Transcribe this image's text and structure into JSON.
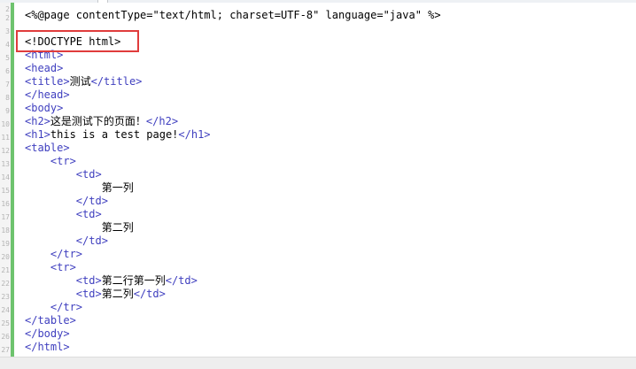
{
  "gutter": {
    "line_numbers": [
      "2",
      "2",
      "3",
      "4",
      "5",
      "6",
      "7",
      "8",
      "9",
      "10",
      "11",
      "12",
      "13",
      "14",
      "15",
      "16",
      "17",
      "18",
      "19",
      "20",
      "21",
      "22",
      "23",
      "24",
      "25",
      "26",
      "27"
    ]
  },
  "code": {
    "directive": "<%@page contentType=\"text/html; charset=UTF-8\" language=\"java\" %>",
    "doctype": "<!DOCTYPE html>",
    "lines": [
      {
        "indent": "",
        "tag_open": "<html>",
        "text": "",
        "tag_close": ""
      },
      {
        "indent": "",
        "tag_open": "<head>",
        "text": "",
        "tag_close": ""
      },
      {
        "indent": "",
        "tag_open": "<title>",
        "text": "测试",
        "tag_close": "</title>"
      },
      {
        "indent": "",
        "tag_open": "</head>",
        "text": "",
        "tag_close": ""
      },
      {
        "indent": "",
        "tag_open": "<body>",
        "text": "",
        "tag_close": ""
      },
      {
        "indent": "",
        "tag_open": "<h2>",
        "text": "这是测试下的页面！",
        "tag_close": "</h2>"
      },
      {
        "indent": "",
        "tag_open": "<h1>",
        "text": "this is a test page!",
        "tag_close": "</h1>"
      },
      {
        "indent": "",
        "tag_open": "<table>",
        "text": "",
        "tag_close": ""
      },
      {
        "indent": "    ",
        "tag_open": "<tr>",
        "text": "",
        "tag_close": ""
      },
      {
        "indent": "        ",
        "tag_open": "<td>",
        "text": "",
        "tag_close": ""
      },
      {
        "indent": "            ",
        "tag_open": "",
        "text": "第一列",
        "tag_close": ""
      },
      {
        "indent": "        ",
        "tag_open": "</td>",
        "text": "",
        "tag_close": ""
      },
      {
        "indent": "        ",
        "tag_open": "<td>",
        "text": "",
        "tag_close": ""
      },
      {
        "indent": "            ",
        "tag_open": "",
        "text": "第二列",
        "tag_close": ""
      },
      {
        "indent": "        ",
        "tag_open": "</td>",
        "text": "",
        "tag_close": ""
      },
      {
        "indent": "    ",
        "tag_open": "</tr>",
        "text": "",
        "tag_close": ""
      },
      {
        "indent": "    ",
        "tag_open": "<tr>",
        "text": "",
        "tag_close": ""
      },
      {
        "indent": "        ",
        "tag_open": "<td>",
        "text": "第二行第一列",
        "tag_close": "</td>"
      },
      {
        "indent": "        ",
        "tag_open": "<td>",
        "text": "第二列",
        "tag_close": "</td>"
      },
      {
        "indent": "    ",
        "tag_open": "</tr>",
        "text": "",
        "tag_close": ""
      },
      {
        "indent": "",
        "tag_open": "</table>",
        "text": "",
        "tag_close": ""
      },
      {
        "indent": "",
        "tag_open": "</body>",
        "text": "",
        "tag_close": ""
      },
      {
        "indent": "",
        "tag_open": "</html>",
        "text": "",
        "tag_close": ""
      }
    ]
  },
  "colors": {
    "tag": "#3f3fbf",
    "text": "#000000",
    "gutter_bar": "#6ec36e",
    "highlight_border": "#e03c3c"
  }
}
